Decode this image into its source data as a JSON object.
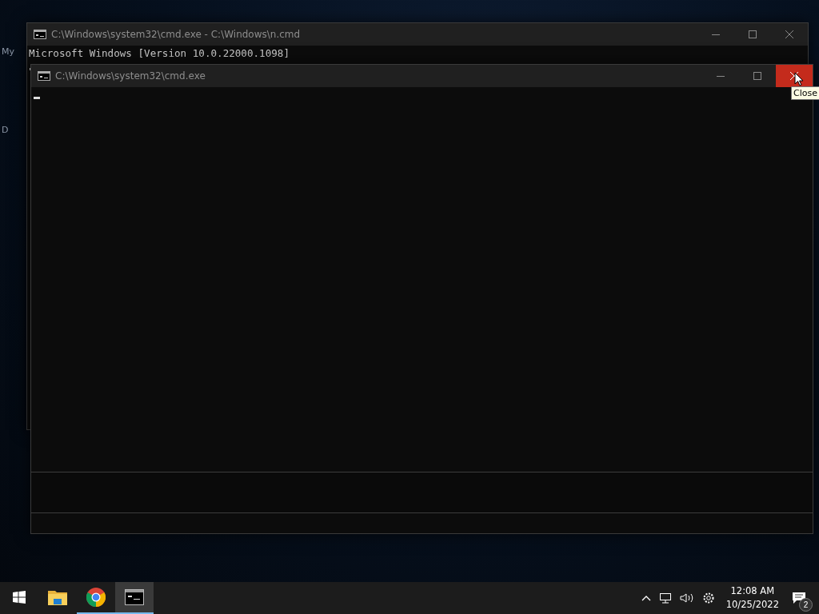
{
  "desktop": {
    "icons": [
      {
        "label": "My"
      },
      {
        "label": "D"
      }
    ]
  },
  "windows": [
    {
      "title": "C:\\Windows\\system32\\cmd.exe - C:\\Windows\\n.cmd",
      "lines": [
        "Microsoft Windows [Version 10.0.22000.1098]"
      ],
      "close_hovered": false
    },
    {
      "title": "C:\\Windows\\system32\\cmd.exe",
      "close_hovered": true
    }
  ],
  "tooltip": {
    "text": "Close"
  },
  "taskbar": {
    "apps": [
      {
        "kind": "explorer",
        "running": false,
        "selected": false
      },
      {
        "kind": "chrome",
        "running": true,
        "selected": false
      },
      {
        "kind": "terminal",
        "running": true,
        "selected": true
      }
    ],
    "clock": {
      "time": "12:08 AM",
      "date": "10/25/2022"
    },
    "notifications": {
      "count": "2"
    }
  }
}
